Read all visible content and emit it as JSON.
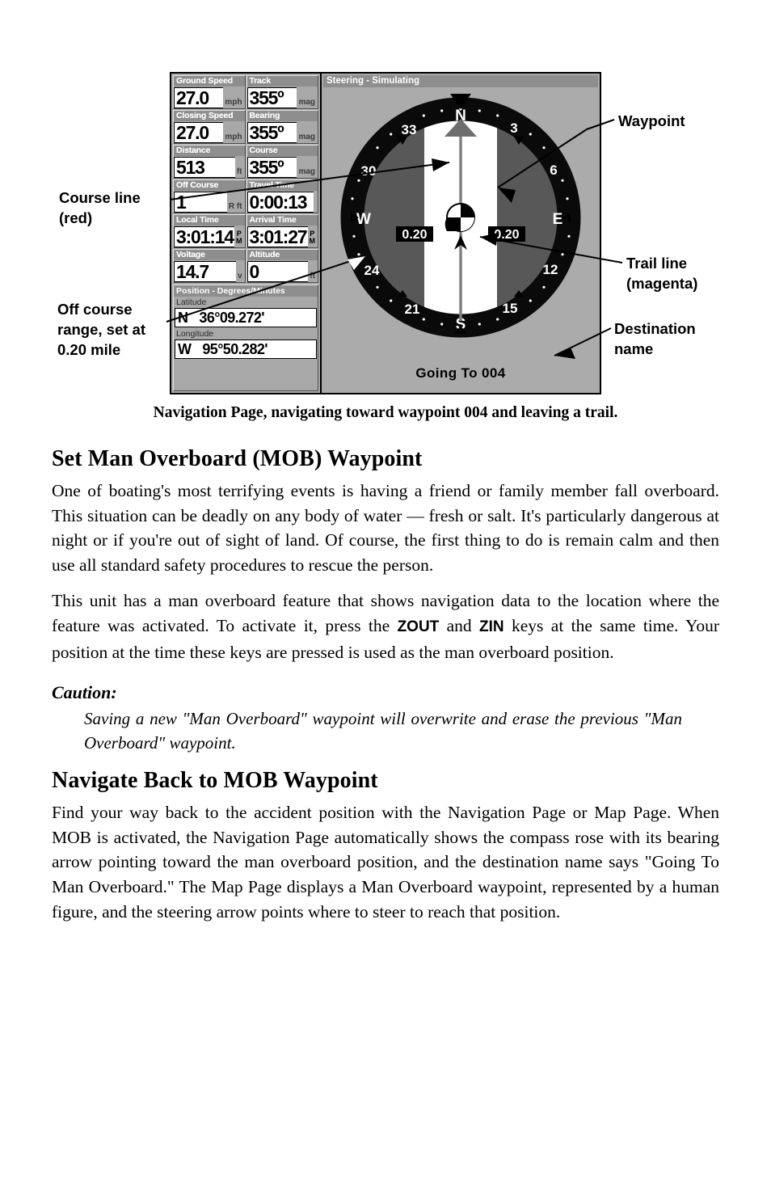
{
  "figure": {
    "gps_screen": {
      "steering_title": "Steering - Simulating",
      "destination_name": "Going To 004",
      "data_cells": [
        {
          "label": "Ground Speed",
          "value": "27.0",
          "unit": "mph",
          "unit_style": "inline"
        },
        {
          "label": "Track",
          "value": "355º",
          "unit": "mag",
          "unit_style": "inline"
        },
        {
          "label": "Closing Speed",
          "value": "27.0",
          "unit": "mph",
          "unit_style": "inline"
        },
        {
          "label": "Bearing",
          "value": "355º",
          "unit": "mag",
          "unit_style": "inline"
        },
        {
          "label": "Distance",
          "value": "513",
          "unit": "ft",
          "unit_style": "inline"
        },
        {
          "label": "Course",
          "value": "355º",
          "unit": "mag",
          "unit_style": "inline"
        },
        {
          "label": "Off Course",
          "value": "1",
          "unit": "R ft",
          "unit_style": "inline"
        },
        {
          "label": "Travel Time",
          "value": "0:00:13",
          "unit": "",
          "unit_style": "inline"
        },
        {
          "label": "Local Time",
          "value": "3:01:14",
          "unit": "P M",
          "unit_style": "stacked"
        },
        {
          "label": "Arrival Time",
          "value": "3:01:27",
          "unit": "P M",
          "unit_style": "stacked"
        },
        {
          "label": "Voltage",
          "value": "14.7",
          "unit": "v",
          "unit_style": "inline"
        },
        {
          "label": "Altitude",
          "value": "0",
          "unit": "ft",
          "unit_style": "inline"
        }
      ],
      "position": {
        "header": "Position - Degrees/Minutes",
        "latitude_label": "Latitude",
        "latitude_hemisphere": "N",
        "latitude_value": "36°09.272'",
        "longitude_label": "Longitude",
        "longitude_hemisphere": "W",
        "longitude_value": "95°50.282'"
      },
      "compass": {
        "cardinals": [
          "N",
          "E",
          "S",
          "W"
        ],
        "tick_numbers": [
          "3",
          "6",
          "12",
          "15",
          "21",
          "24",
          "30",
          "33"
        ],
        "off_course_left": "0.20",
        "off_course_right": "0.20"
      }
    },
    "callouts": [
      {
        "id": "waypoint",
        "lines": [
          "Waypoint"
        ]
      },
      {
        "id": "trail",
        "lines": [
          "Trail line",
          "(magenta)"
        ]
      },
      {
        "id": "dest",
        "lines": [
          "Destination",
          "name"
        ]
      },
      {
        "id": "course",
        "lines": [
          "Course line",
          "(red)"
        ]
      },
      {
        "id": "off-course",
        "lines": [
          "Off course",
          "range, set at",
          "0.20 mile"
        ]
      }
    ],
    "caption": "Navigation Page, navigating toward waypoint 004 and leaving a trail."
  },
  "content": {
    "heading_mob": "Set Man Overboard (MOB) Waypoint",
    "para_1": "One of boating's most terrifying events is having a friend or family member fall overboard. This situation can be deadly on any body of water — fresh or salt. It's particularly dangerous at night or if you're out of sight of land. Of course, the first thing to do is remain calm and then use all standard safety procedures to rescue the person.",
    "para_2_part_1": "This unit has a man overboard feature that shows navigation data to the location where the feature was activated. To activate it, press the ",
    "para_2_key_1": "ZOUT",
    "para_2_part_2": " and ",
    "para_2_key_2": "ZIN",
    "para_2_part_3": " keys at the same time. Your position at the time these keys are pressed is used as the man overboard position.",
    "caution_label": "Caution:",
    "caution_text": "Saving a new \"Man Overboard\" waypoint will overwrite and erase the previous \"Man Overboard\" waypoint.",
    "heading_navigate": "Navigate Back to MOB Waypoint",
    "para_3": "Find your way back to the accident position with the Navigation Page or Map Page. When MOB is activated, the Navigation Page automatically shows the compass rose with its bearing arrow pointing toward the man overboard position, and the destination name says \"Going To Man Overboard.\" The Map Page displays a Man Overboard waypoint, represented by a human figure, and the steering arrow points where to steer to reach that position."
  },
  "colors": {
    "screen_background": "#ababab",
    "compass_ring": "#000000",
    "compass_inner": "#585858",
    "corridor": "#ffffff",
    "label_bar": "#8e8e8e"
  }
}
